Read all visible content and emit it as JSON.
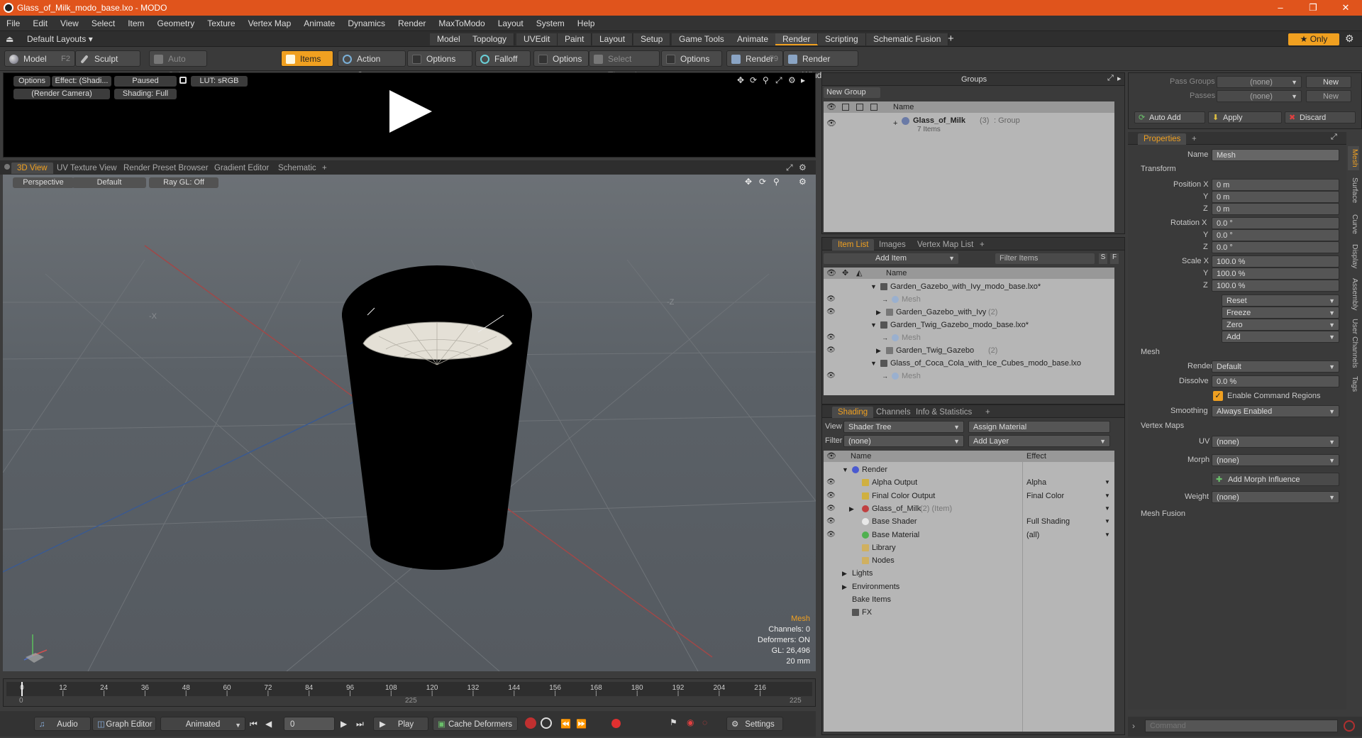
{
  "window": {
    "title": "Glass_of_Milk_modo_base.lxo - MODO",
    "minimize": "–",
    "maximize": "❐",
    "close": "✕"
  },
  "menu": [
    "File",
    "Edit",
    "View",
    "Select",
    "Item",
    "Geometry",
    "Texture",
    "Vertex Map",
    "Animate",
    "Dynamics",
    "Render",
    "MaxToModo",
    "Layout",
    "System",
    "Help"
  ],
  "layoutbar": {
    "preset": "Default Layouts ▾",
    "tabs": [
      "Model",
      "Topology",
      "UVEdit",
      "Paint",
      "Layout",
      "Setup",
      "Game Tools",
      "Animate",
      "Render",
      "Scripting",
      "Schematic Fusion"
    ],
    "active": "Render",
    "plus": "+",
    "only": "★  Only",
    "gear": "⚙"
  },
  "toolbar": {
    "model": "Model",
    "model_key": "F2",
    "sculpt": "Sculpt",
    "auto_select": "Auto Select",
    "items": "Items",
    "action_center": "Action Center",
    "options1": "Options",
    "falloff": "Falloff",
    "options2": "Options",
    "select_through": "Select Through",
    "options3": "Options",
    "render": "Render",
    "render_key": "F9",
    "render_window": "Render Window"
  },
  "preview": {
    "options": "Options",
    "effect": "Effect: (Shadi...",
    "paused": "Paused",
    "lut": "LUT: sRGB",
    "camera": "(Render Camera)",
    "shading": "Shading: Full"
  },
  "viewport_tabs": {
    "tabs": [
      "3D View",
      "UV Texture View",
      "Render Preset Browser",
      "Gradient Editor",
      "Schematic"
    ],
    "active": "3D View",
    "plus": "+"
  },
  "viewport": {
    "perspective": "Perspective",
    "default": "Default",
    "raygl": "Ray GL: Off",
    "info": {
      "title": "Mesh",
      "channels": "Channels: 0",
      "deformers": "Deformers: ON",
      "gl": "GL: 26,496",
      "size": "20 mm"
    },
    "axis_x": "-X",
    "axis_z": "-Z"
  },
  "timeline": {
    "ticks": [
      "0",
      "12",
      "24",
      "36",
      "48",
      "60",
      "72",
      "84",
      "96",
      "108",
      "120",
      "132",
      "144",
      "156",
      "168",
      "180",
      "192",
      "204",
      "216"
    ],
    "start": "0",
    "mid": "225",
    "end": "225"
  },
  "bottombar": {
    "audio": "Audio",
    "graph_editor": "Graph Editor",
    "animated": "Animated",
    "frame": "0",
    "play": "Play",
    "cache": "Cache Deformers",
    "settings": "Settings"
  },
  "groups": {
    "title": "Groups",
    "new_group": "New Group",
    "col_name": "Name",
    "item_name": "Glass_of_Milk",
    "item_count": "(3)",
    "item_type": ": Group",
    "item_sub": "7 Items"
  },
  "itemlist": {
    "tabs": [
      "Item List",
      "Images",
      "Vertex Map List"
    ],
    "active": "Item List",
    "plus": "+",
    "add_item": "Add Item",
    "filter": "Filter Items",
    "col_name": "Name",
    "rows": [
      {
        "label": "Garden_Gazebo_with_Ivy_modo_base.lxo*",
        "count": "",
        "indent": 0,
        "kind": "scene",
        "dim": false
      },
      {
        "label": "Mesh",
        "count": "",
        "indent": 2,
        "kind": "mesh",
        "dim": true
      },
      {
        "label": "Garden_Gazebo_with_Ivy",
        "count": "(2)",
        "indent": 1,
        "kind": "group",
        "dim": false
      },
      {
        "label": "Garden_Twig_Gazebo_modo_base.lxo*",
        "count": "",
        "indent": 0,
        "kind": "scene",
        "dim": false
      },
      {
        "label": "Mesh",
        "count": "",
        "indent": 2,
        "kind": "mesh",
        "dim": true
      },
      {
        "label": "Garden_Twig_Gazebo",
        "count": "(2)",
        "indent": 1,
        "kind": "group",
        "dim": false
      },
      {
        "label": "Glass_of_Coca_Cola_with_Ice_Cubes_modo_base.lxo",
        "count": "",
        "indent": 0,
        "kind": "scene",
        "dim": false
      },
      {
        "label": "Mesh",
        "count": "",
        "indent": 2,
        "kind": "mesh",
        "dim": true
      }
    ]
  },
  "shading": {
    "tabs": [
      "Shading",
      "Channels",
      "Info & Statistics"
    ],
    "active": "Shading",
    "plus": "+",
    "view_label": "View",
    "view": "Shader Tree",
    "assign": "Assign Material",
    "filter_label": "Filter",
    "filter": "(none)",
    "add_layer": "Add Layer",
    "col_name": "Name",
    "col_effect": "Effect",
    "rows": [
      {
        "label": "Render",
        "extra": "",
        "effect": "",
        "indent": 0,
        "icon": "render"
      },
      {
        "label": "Alpha Output",
        "extra": "",
        "effect": "Alpha",
        "indent": 1,
        "icon": "output"
      },
      {
        "label": "Final Color Output",
        "extra": "",
        "effect": "Final Color",
        "indent": 1,
        "icon": "output"
      },
      {
        "label": "Glass_of_Milk",
        "extra": "(2) (Item)",
        "effect": "",
        "indent": 1,
        "icon": "material"
      },
      {
        "label": "Base Shader",
        "extra": "",
        "effect": "Full Shading",
        "indent": 1,
        "icon": "shader"
      },
      {
        "label": "Base Material",
        "extra": "",
        "effect": "(all)",
        "indent": 1,
        "icon": "basemat"
      },
      {
        "label": "Library",
        "extra": "",
        "effect": "",
        "indent": 1,
        "icon": "folder"
      },
      {
        "label": "Nodes",
        "extra": "",
        "effect": "",
        "indent": 1,
        "icon": "folder"
      },
      {
        "label": "Lights",
        "extra": "",
        "effect": "",
        "indent": 0,
        "icon": ""
      },
      {
        "label": "Environments",
        "extra": "",
        "effect": "",
        "indent": 0,
        "icon": ""
      },
      {
        "label": "Bake Items",
        "extra": "",
        "effect": "",
        "indent": 0,
        "icon": ""
      },
      {
        "label": "FX",
        "extra": "",
        "effect": "",
        "indent": 0,
        "icon": "fx"
      }
    ]
  },
  "passes": {
    "pass_groups_label": "Pass Groups",
    "pass_groups": "(none)",
    "passes_label": "Passes",
    "passes": "(none)",
    "new": "New",
    "auto_add": "Auto Add",
    "apply": "Apply",
    "discard": "Discard"
  },
  "properties": {
    "tab": "Properties",
    "plus": "+",
    "name_label": "Name",
    "name": "Mesh",
    "transform": "Transform",
    "position_label": "Position X",
    "position": [
      "0 m",
      "0 m",
      "0 m"
    ],
    "rotation_label": "Rotation X",
    "rotation": [
      "0.0 °",
      "0.0 °",
      "0.0 °"
    ],
    "scale_label": "Scale X",
    "scale": [
      "100.0 %",
      "100.0 %",
      "100.0 %"
    ],
    "y": "Y",
    "z": "Z",
    "actions": [
      "Reset",
      "Freeze",
      "Zero",
      "Add"
    ],
    "mesh_section": "Mesh",
    "render_label": "Render",
    "render": "Default",
    "dissolve_label": "Dissolve",
    "dissolve": "0.0 %",
    "enable_cmd": "Enable Command Regions",
    "smoothing_label": "Smoothing",
    "smoothing": "Always Enabled",
    "vertex_maps": "Vertex Maps",
    "uv_label": "UV",
    "uv": "(none)",
    "morph_label": "Morph",
    "morph": "(none)",
    "add_morph": "Add Morph Influence",
    "weight_label": "Weight",
    "weight": "(none)",
    "mesh_fusion": "Mesh Fusion"
  },
  "sidetabs": [
    "Mesh",
    "Surface",
    "Curve",
    "Display",
    "Assembly",
    "User Channels",
    "Tags"
  ],
  "command": {
    "placeholder": "Command"
  },
  "colors": {
    "accent": "#f0a020",
    "titlebar": "#e0541c"
  }
}
